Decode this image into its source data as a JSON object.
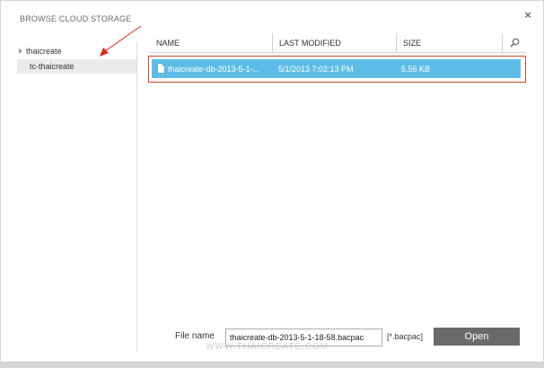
{
  "dialog": {
    "title": "BROWSE CLOUD STORAGE",
    "close_glyph": "×"
  },
  "tree": {
    "items": [
      {
        "label": "thaicreate",
        "expandable": true
      },
      {
        "label": "tc-thaicreate",
        "selected": true
      }
    ]
  },
  "file_list": {
    "columns": [
      "NAME",
      "LAST MODIFIED",
      "SIZE"
    ],
    "rows": [
      {
        "name": "thaicreate-db-2013-5-1-...",
        "modified": "5/1/2013 7:02:13 PM",
        "size": "5.56 KB",
        "selected": true
      }
    ]
  },
  "footer": {
    "file_name_label": "File name",
    "file_name_value": "thaicreate-db-2013-5-1-18-58.bacpac",
    "extension_filter": "[*.bacpac]",
    "open_label": "Open"
  },
  "watermark": "WWW.THAICREATE.COM",
  "colors": {
    "selection_blue": "#5ebde7",
    "annotation_red": "#d9291c",
    "open_button_gray": "#6a6a6a"
  },
  "icons": {
    "close": "close-icon",
    "search": "search-icon",
    "file": "document-icon",
    "expand": "triangle-right-icon"
  }
}
